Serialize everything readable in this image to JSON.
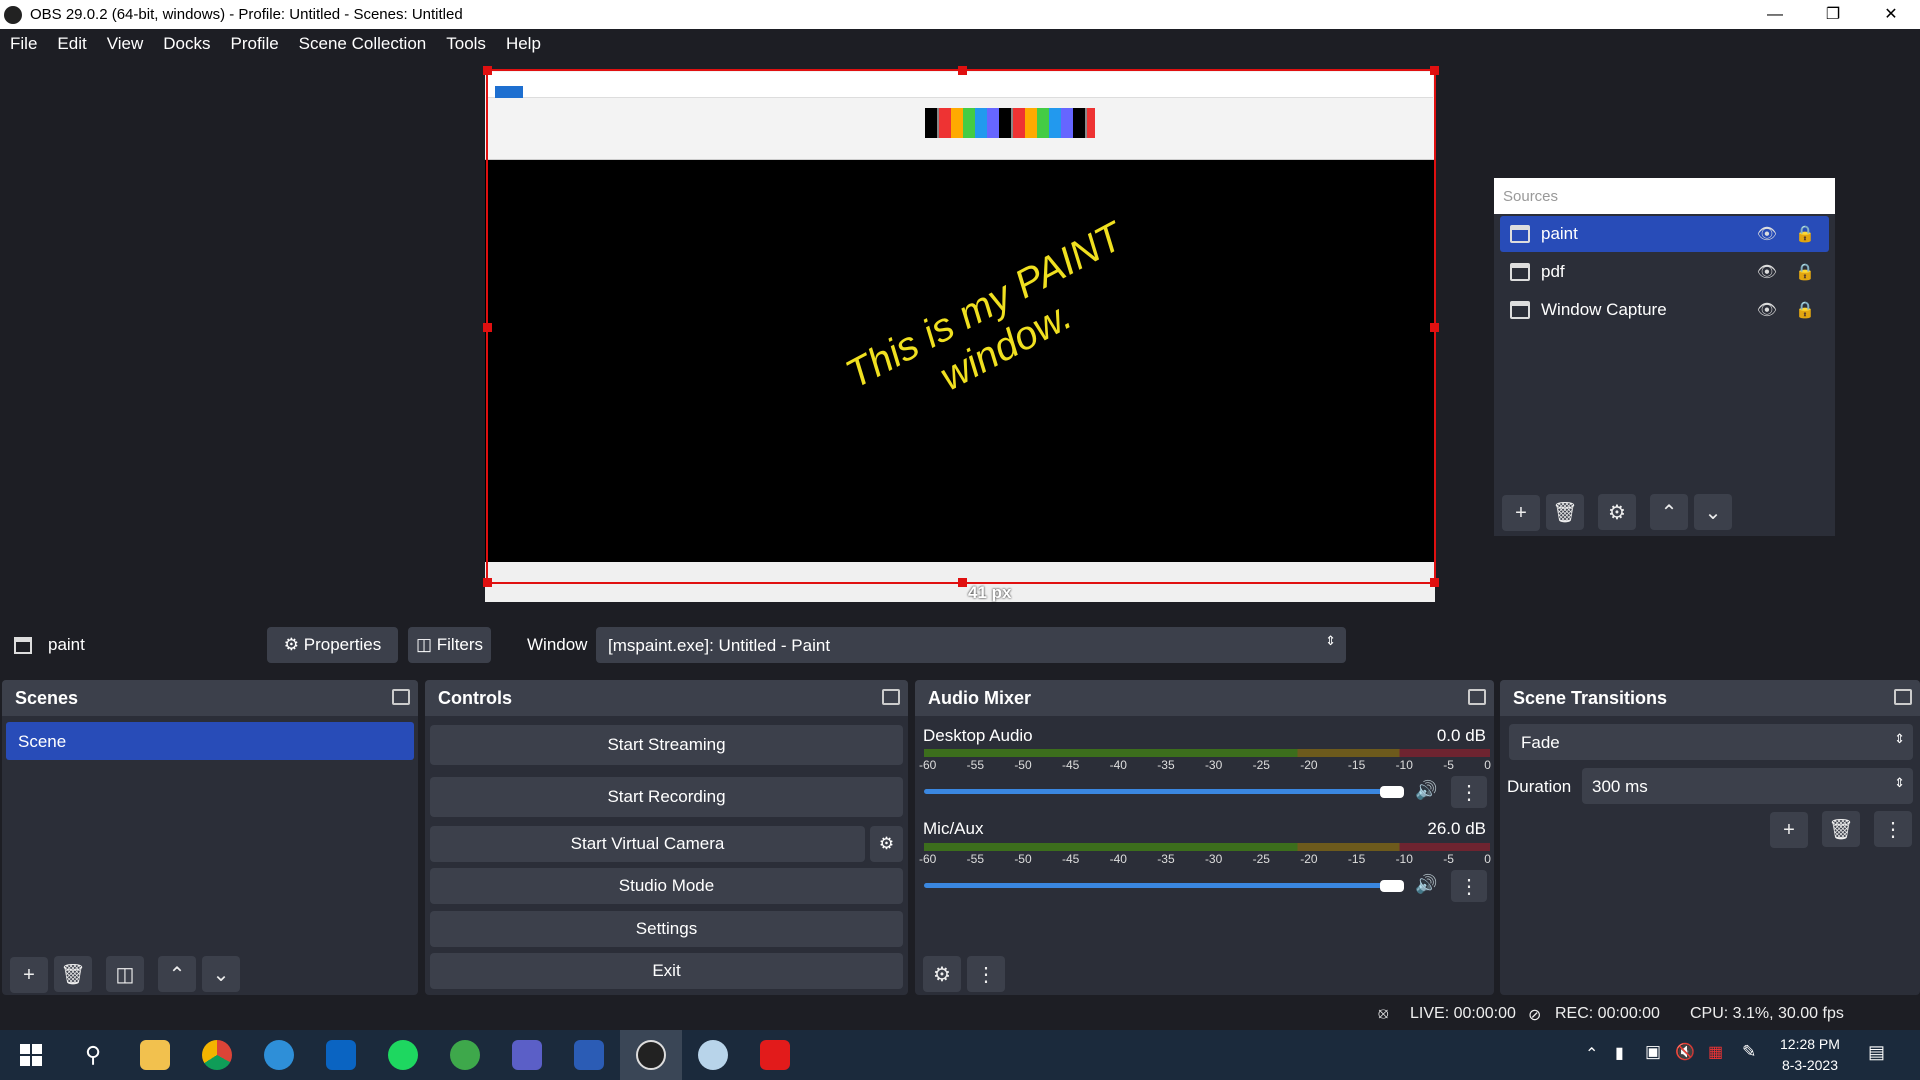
{
  "window": {
    "title": "OBS 29.0.2 (64-bit, windows) - Profile: Untitled - Scenes: Untitled"
  },
  "menu": [
    "File",
    "Edit",
    "View",
    "Docks",
    "Profile",
    "Scene Collection",
    "Tools",
    "Help"
  ],
  "preview": {
    "paint_text": "This is my PAINT window.",
    "resize_label": "41 px"
  },
  "sources": {
    "header": "Sources",
    "items": [
      {
        "name": "paint",
        "visible": true,
        "locked": true,
        "selected": true
      },
      {
        "name": "pdf",
        "visible": true,
        "locked": true
      },
      {
        "name": "Window Capture",
        "visible": true,
        "locked": true
      }
    ]
  },
  "context": {
    "source": "paint",
    "properties": "Properties",
    "filters": "Filters",
    "window_label": "Window",
    "window_value": "[mspaint.exe]: Untitled - Paint"
  },
  "scenes": {
    "title": "Scenes",
    "items": [
      "Scene"
    ]
  },
  "controls": {
    "title": "Controls",
    "start_streaming": "Start Streaming",
    "start_recording": "Start Recording",
    "start_virtual_camera": "Start Virtual Camera",
    "studio_mode": "Studio Mode",
    "settings": "Settings",
    "exit": "Exit"
  },
  "audio": {
    "title": "Audio Mixer",
    "ticks": [
      "-60",
      "-55",
      "-50",
      "-45",
      "-40",
      "-35",
      "-30",
      "-25",
      "-20",
      "-15",
      "-10",
      "-5",
      "0"
    ],
    "channels": [
      {
        "name": "Desktop Audio",
        "db": "0.0 dB",
        "volume_percent": 100
      },
      {
        "name": "Mic/Aux",
        "db": "26.0 dB",
        "volume_percent": 100
      }
    ]
  },
  "transitions": {
    "title": "Scene Transitions",
    "selected": "Fade",
    "duration_label": "Duration",
    "duration": "300 ms"
  },
  "status": {
    "live": "LIVE: 00:00:00",
    "rec": "REC: 00:00:00",
    "cpu": "CPU: 3.1%, 30.00 fps"
  },
  "taskbar": {
    "time": "12:28 PM",
    "date": "8-3-2023",
    "apps": [
      "windows-start",
      "search",
      "file-explorer",
      "chrome",
      "edge",
      "outlook",
      "spotify",
      "maps",
      "teams",
      "word",
      "obs",
      "paint",
      "acrobat"
    ]
  }
}
